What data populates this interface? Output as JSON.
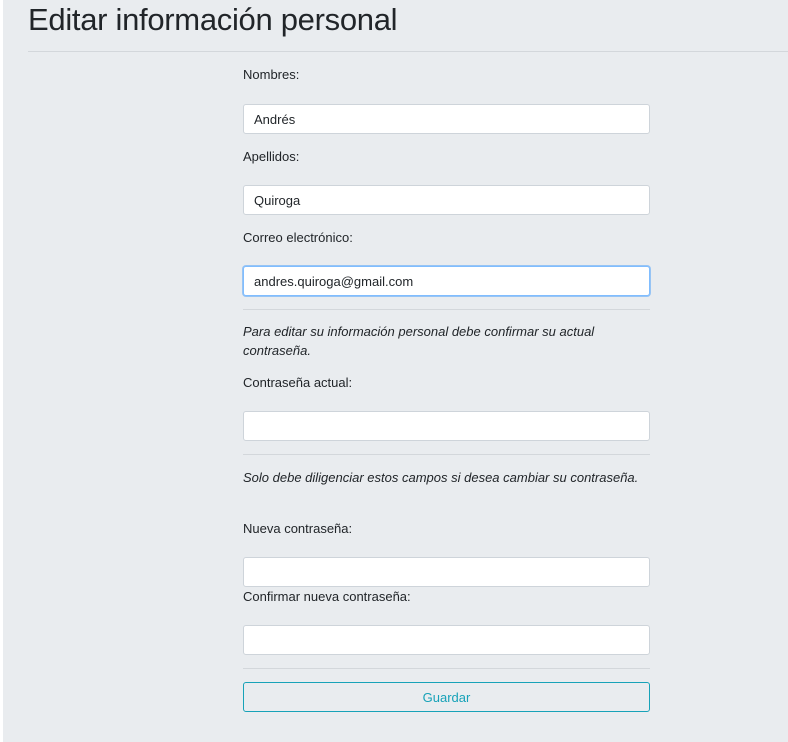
{
  "page": {
    "title": "Editar información personal"
  },
  "form": {
    "first_name": {
      "label": "Nombres:",
      "value": "Andrés"
    },
    "last_name": {
      "label": "Apellidos:",
      "value": "Quiroga"
    },
    "email": {
      "label": "Correo electrónico:",
      "value": "andres.quiroga@gmail.com"
    },
    "confirm_note": "Para editar su información personal debe confirmar su actual contraseña.",
    "current_password": {
      "label": "Contraseña actual:",
      "value": ""
    },
    "change_note": "Solo debe diligenciar estos campos si desea cambiar su contraseña.",
    "new_password": {
      "label": "Nueva contraseña:",
      "value": ""
    },
    "confirm_new_password": {
      "label": "Confirmar nueva contraseña:",
      "value": ""
    },
    "submit_label": "Guardar"
  },
  "colors": {
    "background": "#e9ecef",
    "focus_border": "#80bdff",
    "button_outline": "#17a2b8"
  }
}
